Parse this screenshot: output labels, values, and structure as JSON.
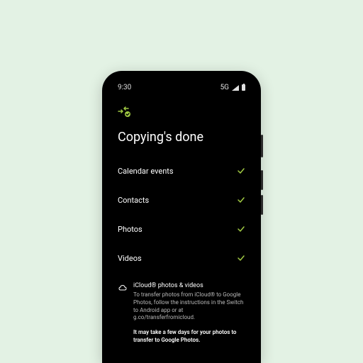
{
  "status_bar": {
    "time": "9:30",
    "network": "5G"
  },
  "colors": {
    "accent": "#a0c943",
    "background": "#e3f2e4"
  },
  "header": {
    "title": "Copying's done"
  },
  "items": [
    {
      "label": "Calendar events",
      "done": true
    },
    {
      "label": "Contacts",
      "done": true
    },
    {
      "label": "Photos",
      "done": true
    },
    {
      "label": "Videos",
      "done": true
    }
  ],
  "info": {
    "title": "iCloud® photos & videos",
    "body": "To transfer photos from iCloud® to Google Photos, follow the instructions in the Switch to Android app or at g.co/transferfromicloud.",
    "note": "It may take a few days for your photos to transfer to Google Photos."
  }
}
